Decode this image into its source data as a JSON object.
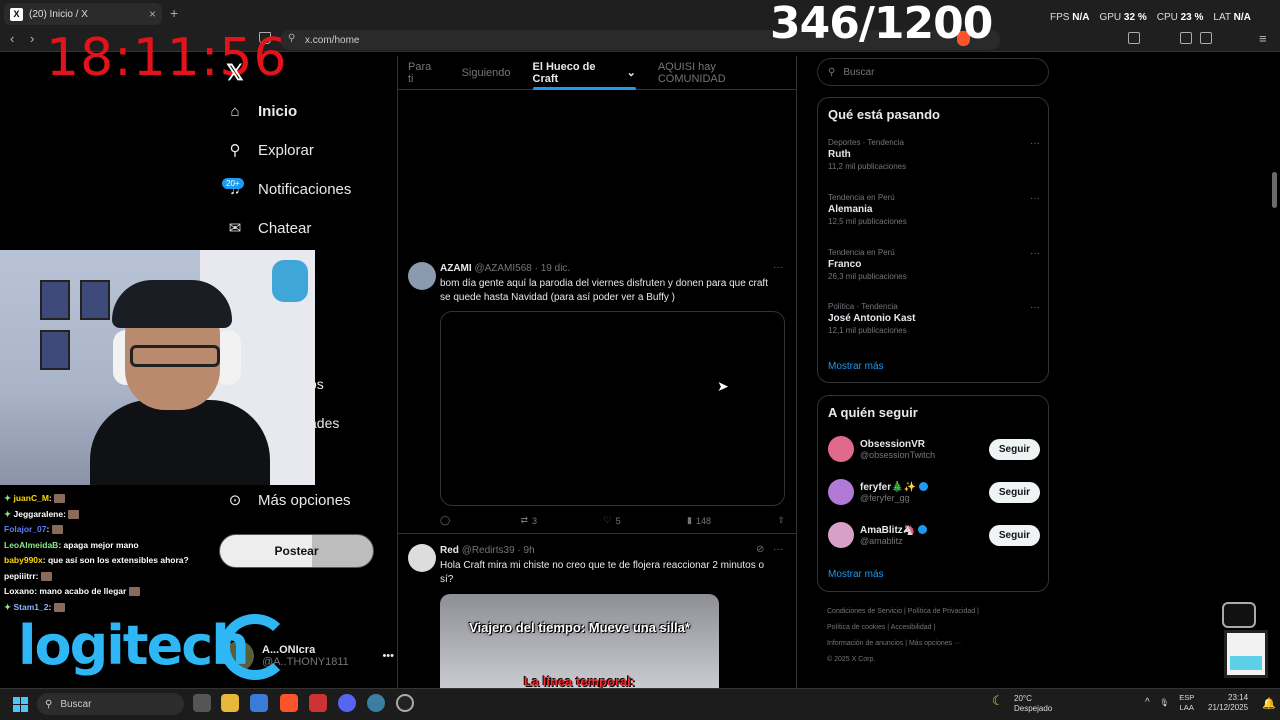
{
  "browser": {
    "tab_title": "(20) Inicio / X",
    "tab_favicon": "X",
    "url": "x.com/home",
    "new_tab": "+",
    "close": "×"
  },
  "overlay": {
    "counter": "346/1200",
    "clock": "18:11:56",
    "fps_label": "FPS",
    "fps_value": "N/A",
    "gpu_label": "GPU",
    "gpu_value": "32 %",
    "cpu_label": "CPU",
    "cpu_value": "23 %",
    "lat_label": "LAT",
    "lat_value": "N/A"
  },
  "sidebar": {
    "items": [
      {
        "label": "Inicio",
        "icon": "home-icon"
      },
      {
        "label": "Explorar",
        "icon": "search-icon"
      },
      {
        "label": "Notificaciones",
        "icon": "bell-icon"
      },
      {
        "label": "Chatear",
        "icon": "mail-icon"
      }
    ],
    "notif_badge": "20+",
    "partial_1": "os",
    "partial_2": "ades",
    "more_options": "Más opciones",
    "post_button": "Postear",
    "profile_name": "A...ONIcra",
    "profile_handle": "@A..THONY1811",
    "profile_dots": "•••"
  },
  "chat": [
    {
      "user": "juanC_M",
      "color": "#ffd700",
      "msg": ":"
    },
    {
      "user": "Jeggaralene",
      "color": "#ffffff",
      "msg": ":"
    },
    {
      "user": "Folajor_07",
      "color": "#5a7dff",
      "msg": ":"
    },
    {
      "user": "LeoAlmeidaB",
      "color": "#8be88b",
      "msg": ": apaga mejor mano"
    },
    {
      "user": "baby990x",
      "color": "#ffd700",
      "msg": ": que así son los extensibles ahora?"
    },
    {
      "user": "pepiiitrr",
      "color": "#ffffff",
      "msg": ":"
    },
    {
      "user": "Loxano",
      "color": "#ffffff",
      "msg": ": mano acabo de llegar"
    },
    {
      "user": "Stam1_2",
      "color": "#8ab4ff",
      "msg": ":"
    }
  ],
  "logo": {
    "text": "logitech"
  },
  "feed": {
    "tabs": [
      "Para ti",
      "Siguiendo",
      "El Hueco de Craft",
      "AQUISI hay COMUNIDAD"
    ],
    "tweets": [
      {
        "name": "AZAMI",
        "handle": "@AZAMI568",
        "date": "· 19 dic.",
        "text": "bom día gente aquí la parodia del viernes disfruten y donen para que craft se quede hasta Navidad (para así poder ver a Buffy      )",
        "replies": "",
        "retweets": "3",
        "likes": "5",
        "views": "148"
      },
      {
        "name": "Red",
        "handle": "@Redirts39",
        "date": "· 9h",
        "text": "Hola Craft mira mi chiste no creo que te de flojera reaccionar 2 minutos o sí?",
        "media_caption_1": "Viajero del tiempo: Mueve una silla*",
        "media_caption_2": "La línea temporal:"
      }
    ]
  },
  "right": {
    "search_placeholder": "Buscar",
    "trends_title": "Qué está pasando",
    "trends": [
      {
        "meta": "Deportes · Tendencia",
        "topic": "Ruth",
        "count": "11,2 mil publicaciones"
      },
      {
        "meta": "Tendencia en Perú",
        "topic": "Alemania",
        "count": "12,5 mil publicaciones"
      },
      {
        "meta": "Tendencia en Perú",
        "topic": "Franco",
        "count": "26,3 mil publicaciones"
      },
      {
        "meta": "Política · Tendencia",
        "topic": "José Antonio Kast",
        "count": "12,1 mil publicaciones"
      }
    ],
    "show_more": "Mostrar más",
    "follow_title": "A quién seguir",
    "follow": [
      {
        "name": "ObsessionVR",
        "handle": "@obsessionTwitch",
        "verified": false,
        "color": "#e06a8c"
      },
      {
        "name": "feryfer🎄✨",
        "handle": "@feryfer_gg",
        "verified": true,
        "color": "#b07ad6"
      },
      {
        "name": "AmaBlitz🦄",
        "handle": "@amablitz",
        "verified": true,
        "color": "#d8a0c8"
      }
    ],
    "follow_button": "Seguir",
    "footer_lines": [
      "Condiciones de Servicio  |  Política de Privacidad  |",
      "Política de cookies  |  Accesibilidad  |",
      "Información de anuncios  |  Más opciones ···",
      "© 2025 X Corp."
    ]
  },
  "taskbar": {
    "search": "Buscar",
    "weather_temp": "20°C",
    "weather_desc": "Despejado",
    "lang": "ESP",
    "lang2": "LAA",
    "time": "23:14",
    "date": "21/12/2025"
  }
}
